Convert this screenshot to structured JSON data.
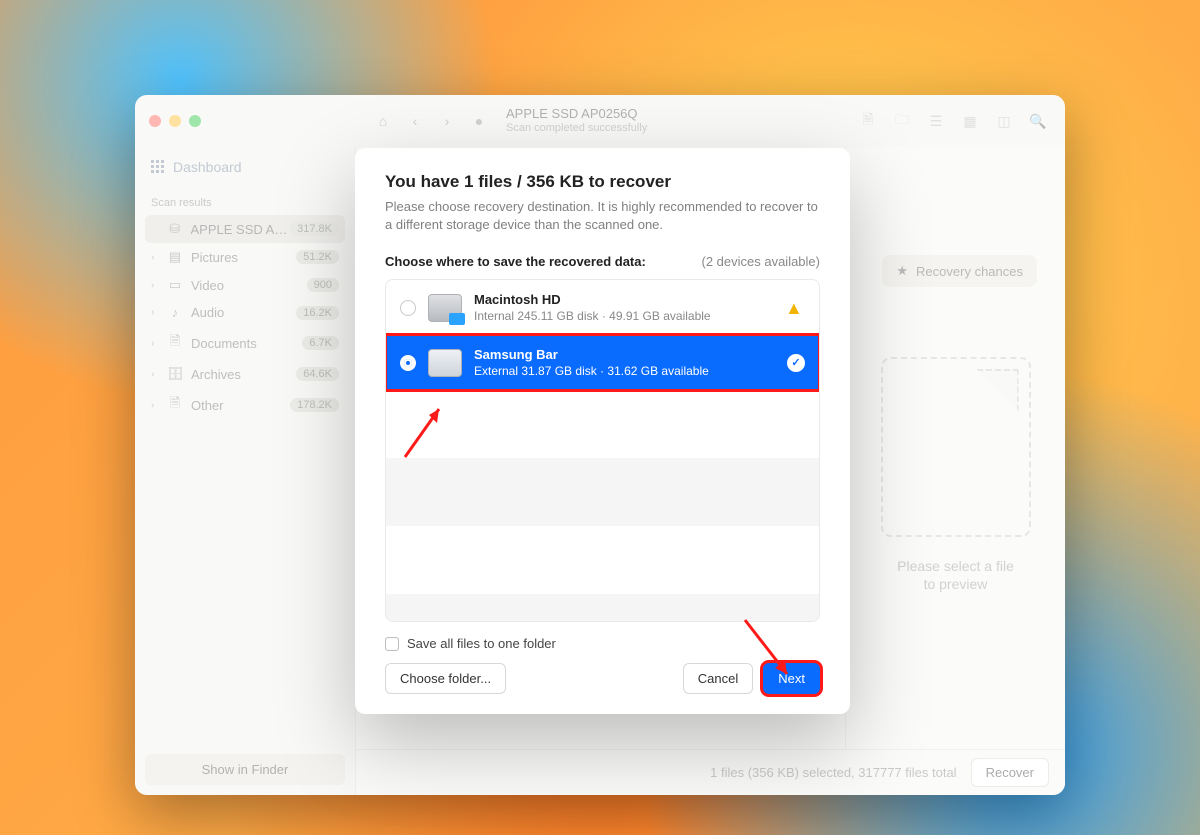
{
  "sidebar": {
    "dashboard": "Dashboard",
    "section": "Scan results",
    "items": [
      {
        "icon": "⛁",
        "label": "APPLE SSD AP...",
        "badge": "317.8K",
        "chev": ""
      },
      {
        "icon": "▤",
        "label": "Pictures",
        "badge": "51.2K",
        "chev": "›"
      },
      {
        "icon": "▭",
        "label": "Video",
        "badge": "900",
        "chev": "›"
      },
      {
        "icon": "♪",
        "label": "Audio",
        "badge": "16.2K",
        "chev": "›"
      },
      {
        "icon": "🗎",
        "label": "Documents",
        "badge": "6.7K",
        "chev": "›"
      },
      {
        "icon": "🗄",
        "label": "Archives",
        "badge": "64.6K",
        "chev": "›"
      },
      {
        "icon": "🗎",
        "label": "Other",
        "badge": "178.2K",
        "chev": "›"
      }
    ],
    "show_in_finder": "Show in Finder"
  },
  "toolbar": {
    "title": "APPLE SSD AP0256Q",
    "subtitle": "Scan completed successfully"
  },
  "preview": {
    "chances": "Recovery chances",
    "placeholder": "Please select a file\nto preview"
  },
  "footer": {
    "status": "1 files (356 KB) selected, 317777 files total",
    "recover": "Recover"
  },
  "modal": {
    "title": "You have 1 files / 356 KB to recover",
    "sub": "Please choose recovery destination. It is highly recommended to recover to a different storage device than the scanned one.",
    "choose_label": "Choose where to save the recovered data:",
    "devices_available": "(2 devices available)",
    "devices": [
      {
        "name": "Macintosh HD",
        "detail": "Internal 245.11 GB disk · 49.91 GB available"
      },
      {
        "name": "Samsung Bar",
        "detail": "External 31.87 GB disk · 31.62 GB available"
      }
    ],
    "save_all": "Save all files to one folder",
    "choose_folder": "Choose folder...",
    "cancel": "Cancel",
    "next": "Next"
  }
}
